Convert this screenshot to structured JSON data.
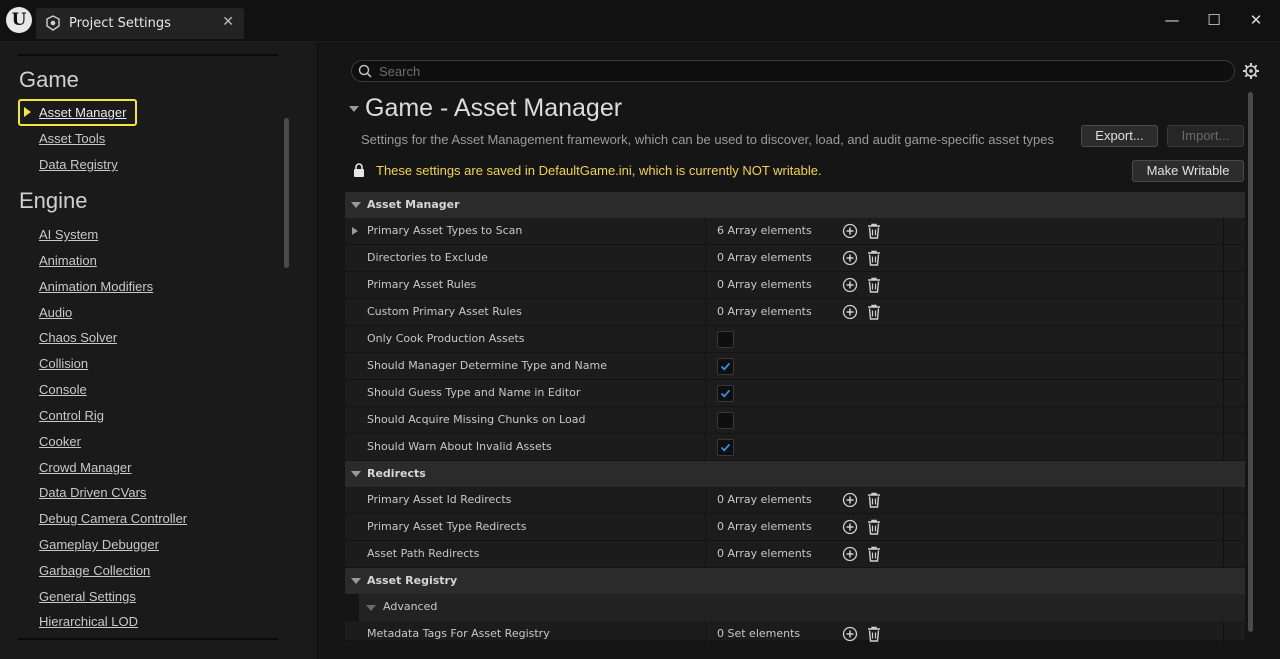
{
  "titlebar": {
    "logo": "U",
    "tab_title": "Project Settings",
    "tab_icon": "settings-cube-icon",
    "close_glyph": "✕",
    "minimize_glyph": "—",
    "maximize_glyph": "☐",
    "window_close_glyph": "✕"
  },
  "sidebar": {
    "game_heading": "Game",
    "game_items": [
      "Asset Manager",
      "Asset Tools",
      "Data Registry"
    ],
    "selected_item": "Asset Manager",
    "engine_heading": "Engine",
    "engine_items": [
      "AI System",
      "Animation",
      "Animation Modifiers",
      "Audio",
      "Chaos Solver",
      "Collision",
      "Console",
      "Control Rig",
      "Cooker",
      "Crowd Manager",
      "Data Driven CVars",
      "Debug Camera Controller",
      "Gameplay Debugger",
      "Garbage Collection",
      "General Settings",
      "Hierarchical LOD"
    ]
  },
  "main": {
    "search_placeholder": "Search",
    "title": "Game - Asset Manager",
    "description": "Settings for the Asset Management framework, which can be used to discover, load, and audit game-specific asset types",
    "export_label": "Export...",
    "import_label": "Import...",
    "warning": "These settings are saved in DefaultGame.ini, which is currently NOT writable.",
    "make_writable_label": "Make Writable"
  },
  "grid": {
    "categories": {
      "asset_manager": "Asset Manager",
      "redirects": "Redirects",
      "asset_registry": "Asset Registry",
      "advanced": "Advanced"
    },
    "rows": [
      {
        "name": "Primary Asset Types to Scan",
        "value": "6 Array elements"
      },
      {
        "name": "Directories to Exclude",
        "value": "0 Array elements"
      },
      {
        "name": "Primary Asset Rules",
        "value": "0 Array elements"
      },
      {
        "name": "Custom Primary Asset Rules",
        "value": "0 Array elements"
      },
      {
        "name": "Only Cook Production Assets",
        "checked": false
      },
      {
        "name": "Should Manager Determine Type and Name",
        "checked": true
      },
      {
        "name": "Should Guess Type and Name in Editor",
        "checked": true
      },
      {
        "name": "Should Acquire Missing Chunks on Load",
        "checked": false
      },
      {
        "name": "Should Warn About Invalid Assets",
        "checked": true
      },
      {
        "name": "Primary Asset Id Redirects",
        "value": "0 Array elements"
      },
      {
        "name": "Primary Asset Type Redirects",
        "value": "0 Array elements"
      },
      {
        "name": "Asset Path Redirects",
        "value": "0 Array elements"
      },
      {
        "name": "Metadata Tags For Asset Registry",
        "value": "0 Set elements"
      }
    ]
  },
  "colors": {
    "accent_highlight": "#f2e73a",
    "warning_text": "#f0d44a",
    "check_blue": "#3b8de0"
  }
}
